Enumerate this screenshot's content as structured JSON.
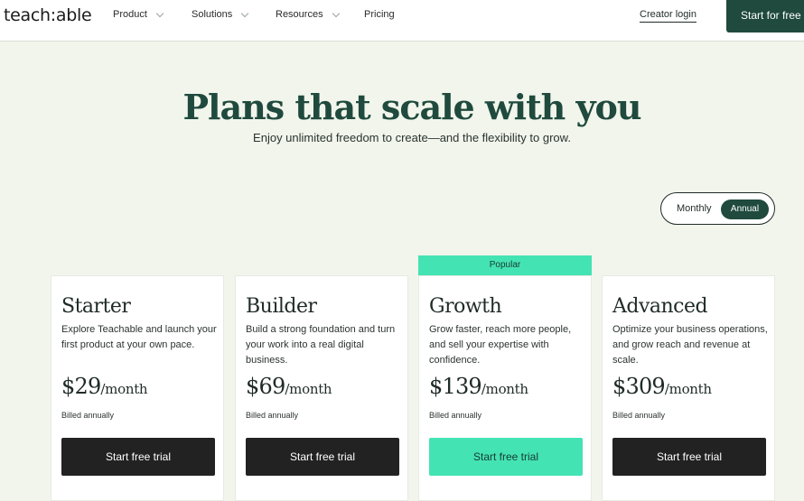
{
  "header": {
    "logo": "teach:able",
    "nav": [
      {
        "label": "Product",
        "has_dropdown": true
      },
      {
        "label": "Solutions",
        "has_dropdown": true
      },
      {
        "label": "Resources",
        "has_dropdown": true
      },
      {
        "label": "Pricing",
        "has_dropdown": false
      }
    ],
    "login_label": "Creator login",
    "cta_label": "Start for free"
  },
  "hero": {
    "title": "Plans that scale with you",
    "subtitle": "Enjoy unlimited freedom to create—and the flexibility to grow."
  },
  "billing_toggle": {
    "options": [
      "Monthly",
      "Annual"
    ],
    "selected": "Annual"
  },
  "plans": [
    {
      "name": "Starter",
      "description": "Explore Teachable and launch your first product at your own pace.",
      "price": "$29",
      "period": "/month",
      "billing": "Billed annually",
      "button": "Start free trial",
      "popular": false
    },
    {
      "name": "Builder",
      "description": "Build a strong foundation and turn your work into a real digital business.",
      "price": "$69",
      "period": "/month",
      "billing": "Billed annually",
      "button": "Start free trial",
      "popular": false
    },
    {
      "name": "Growth",
      "description": "Grow faster, reach more people, and sell your expertise with confidence.",
      "price": "$139",
      "period": "/month",
      "billing": "Billed annually",
      "button": "Start free trial",
      "popular": true,
      "badge": "Popular"
    },
    {
      "name": "Advanced",
      "description": "Optimize your business operations, and grow reach and revenue at scale.",
      "price": "$309",
      "period": "/month",
      "billing": "Billed annually",
      "button": "Start free trial",
      "popular": false
    }
  ],
  "colors": {
    "brand_dark_green": "#1f4a3d",
    "accent_mint": "#44e3b3",
    "page_background": "#f1f5ec",
    "button_dark": "#222222"
  }
}
